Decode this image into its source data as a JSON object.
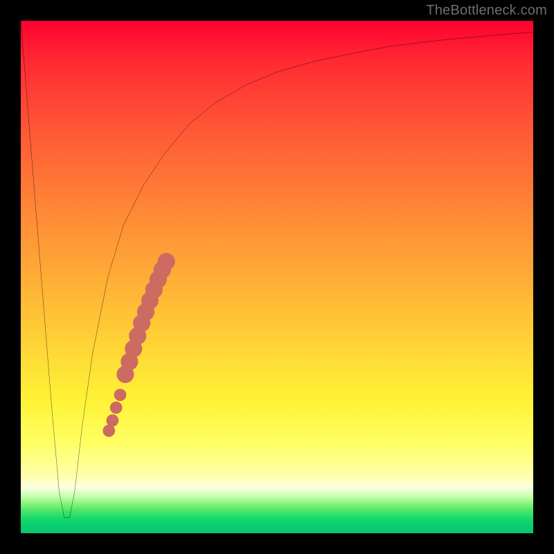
{
  "watermark": "TheBottleneck.com",
  "palette": {
    "frame": "#000000",
    "curve": "#000000",
    "marker": "#cc6b62",
    "gradient_top": "#ff002f",
    "gradient_mid": "#fff236",
    "gradient_bottom": "#05c770"
  },
  "chart_data": {
    "type": "line",
    "title": "",
    "xlabel": "",
    "ylabel": "",
    "xlim": [
      0,
      100
    ],
    "ylim": [
      0,
      100
    ],
    "grid": false,
    "legend": false,
    "series": [
      {
        "name": "bottleneck-curve",
        "x": [
          0,
          2,
          4,
          6,
          7.5,
          8.5,
          9.5,
          10.5,
          12,
          14,
          17,
          20,
          24,
          28,
          33,
          38,
          44,
          50,
          57,
          64,
          72,
          80,
          88,
          95,
          100
        ],
        "y": [
          100,
          75,
          50,
          25,
          8,
          3,
          3,
          8,
          21,
          35,
          50,
          60,
          68,
          74,
          80,
          84,
          87.5,
          90,
          92,
          93.5,
          95,
          96,
          96.8,
          97.4,
          97.8
        ]
      }
    ],
    "markers": {
      "name": "highlighted-range",
      "color": "#cc6b62",
      "points": [
        {
          "x": 17.2,
          "y": 20.0,
          "r": 1.2
        },
        {
          "x": 17.9,
          "y": 22.0,
          "r": 1.2
        },
        {
          "x": 18.6,
          "y": 24.5,
          "r": 1.2
        },
        {
          "x": 19.4,
          "y": 27.0,
          "r": 1.2
        },
        {
          "x": 20.4,
          "y": 31.0,
          "r": 1.7
        },
        {
          "x": 21.2,
          "y": 33.5,
          "r": 1.7
        },
        {
          "x": 22.0,
          "y": 36.0,
          "r": 1.7
        },
        {
          "x": 22.8,
          "y": 38.5,
          "r": 1.7
        },
        {
          "x": 23.6,
          "y": 41.0,
          "r": 1.7
        },
        {
          "x": 24.4,
          "y": 43.2,
          "r": 1.7
        },
        {
          "x": 25.2,
          "y": 45.4,
          "r": 1.7
        },
        {
          "x": 26.0,
          "y": 47.5,
          "r": 1.7
        },
        {
          "x": 26.8,
          "y": 49.5,
          "r": 1.7
        },
        {
          "x": 27.6,
          "y": 51.4,
          "r": 1.7
        },
        {
          "x": 28.4,
          "y": 53.0,
          "r": 1.7
        }
      ]
    }
  }
}
